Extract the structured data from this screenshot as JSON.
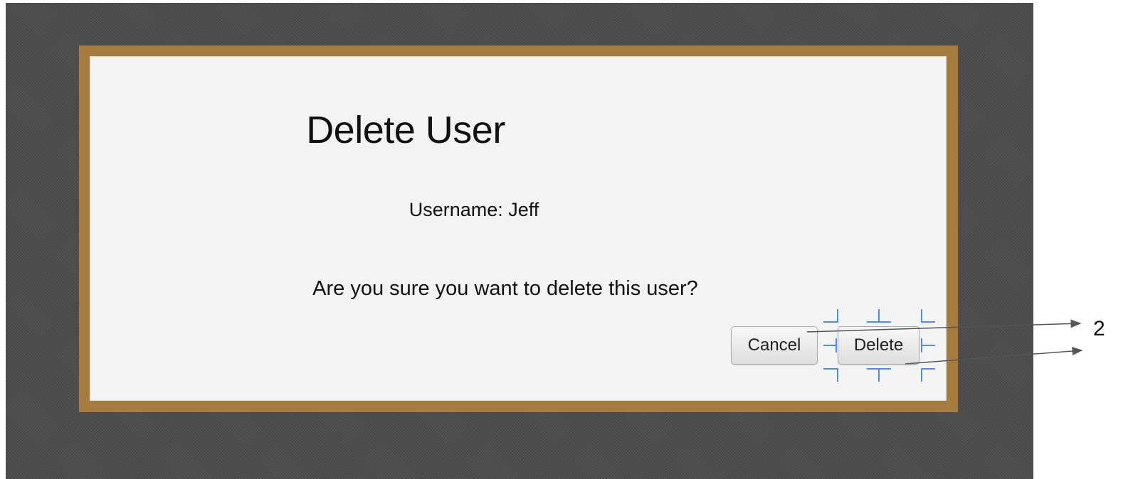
{
  "dialog": {
    "title": "Delete User",
    "username_line": "Username: Jeff",
    "prompt": "Are you sure you want to delete this user?",
    "cancel_label": "Cancel",
    "delete_label": "Delete"
  },
  "annotation": {
    "number": "2"
  },
  "colors": {
    "canvas": "#4d4d4d",
    "frame": "#a57b3e",
    "dialog_bg": "#f3f3f3",
    "selection_handles": "#4a90e2",
    "arrow": "#555555"
  }
}
